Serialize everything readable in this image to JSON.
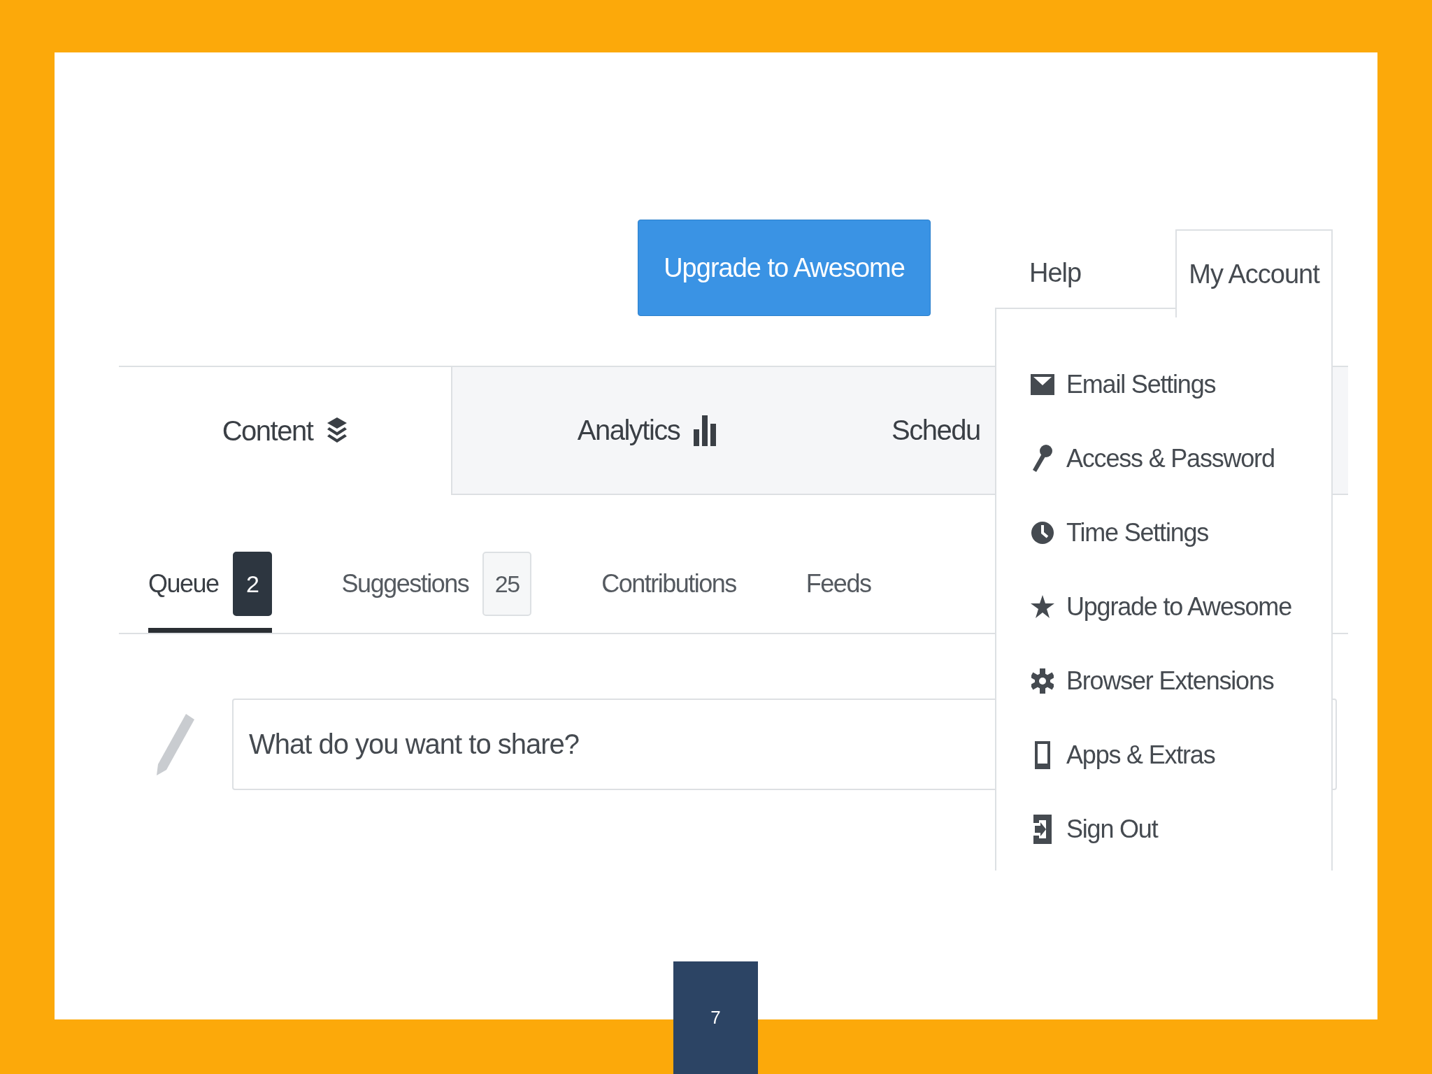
{
  "slide": {
    "page_number": "7"
  },
  "header": {
    "upgrade_button": "Upgrade to Awesome",
    "nav_links": [
      {
        "label": "Help",
        "selected": false
      },
      {
        "label": "My Account",
        "selected": true
      }
    ]
  },
  "main_tabs": [
    {
      "label": "Content",
      "selected": true
    },
    {
      "label": "Analytics",
      "selected": false
    },
    {
      "label": "Schedu",
      "selected": false
    }
  ],
  "sub_tabs": [
    {
      "label": "Queue",
      "count": "2",
      "selected": true
    },
    {
      "label": "Suggestions",
      "count": "25",
      "selected": false
    },
    {
      "label": "Contributions",
      "selected": false
    },
    {
      "label": "Feeds",
      "selected": false
    }
  ],
  "composer": {
    "placeholder": "What do you want to share?"
  },
  "account_menu": {
    "items": [
      {
        "label": "Email Settings"
      },
      {
        "label": "Access & Password"
      },
      {
        "label": "Time Settings"
      },
      {
        "label": "Upgrade to Awesome"
      },
      {
        "label": "Browser Extensions"
      },
      {
        "label": "Apps & Extras"
      },
      {
        "label": "Sign Out"
      }
    ]
  }
}
